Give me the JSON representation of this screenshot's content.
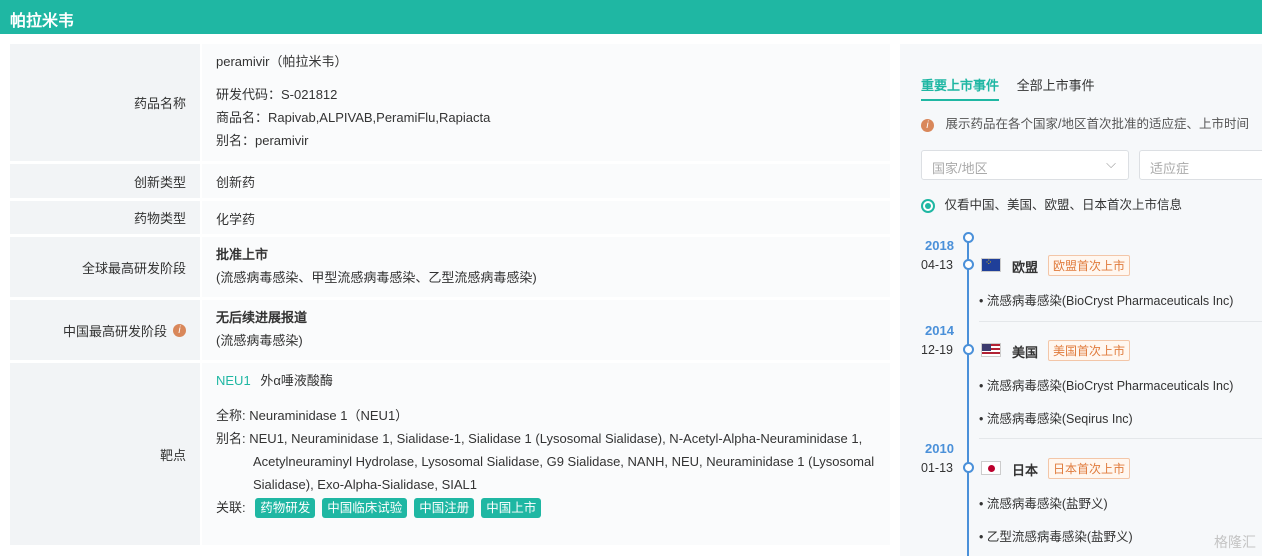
{
  "header": {
    "title": "帕拉米韦"
  },
  "drug": {
    "name_label": "药品名称",
    "name_main": "peramivir（帕拉米韦）",
    "code": "研发代码：S-021812",
    "trade": "商品名：Rapivab,ALPIVAB,PeramiFlu,Rapiacta",
    "alias": "别名：peramivir",
    "innov_label": "创新类型",
    "innov_value": "创新药",
    "type_label": "药物类型",
    "type_value": "化学药",
    "global_label": "全球最高研发阶段",
    "global_stage": "批准上市",
    "global_ind": "(流感病毒感染、甲型流感病毒感染、乙型流感病毒感染)",
    "china_label": "中国最高研发阶段",
    "china_stage": "无后续进展报道",
    "china_ind": "(流感病毒感染)",
    "target_label": "靶点",
    "target_link": "NEU1",
    "target_desc": "外α唾液酸酶",
    "target_full": "全称:  Neuraminidase 1（NEU1）",
    "target_alias_prefix": "别名:",
    "target_alias": "NEU1, Neuraminidase 1, Sialidase-1, Sialidase 1 (Lysosomal Sialidase), N-Acetyl-Alpha-Neuraminidase 1,",
    "target_alias2": "Acetylneuraminyl Hydrolase, Lysosomal Sialidase, G9 Sialidase, NANH, NEU, Neuraminidase 1 (Lysosomal",
    "target_alias3": "Sialidase), Exo-Alpha-Sialidase, SIAL1",
    "related_prefix": "关联:",
    "tags": [
      "药物研发",
      "中国临床试验",
      "中国注册",
      "中国上市"
    ]
  },
  "events": {
    "tabs": [
      "重要上市事件",
      "全部上市事件"
    ],
    "note": "展示药品在各个国家/地区首次批准的适应症、上市时间",
    "country_placeholder": "国家/地区",
    "indication_placeholder": "适应症",
    "radio_label": "仅看中国、美国、欧盟、日本首次上市信息",
    "items": [
      {
        "year": "2018",
        "date": "04-13",
        "country": "欧盟",
        "badge": "欧盟首次上市",
        "indications": [
          "• 流感病毒感染(BioCryst Pharmaceuticals Inc)"
        ]
      },
      {
        "year": "2014",
        "date": "12-19",
        "country": "美国",
        "badge": "美国首次上市",
        "indications": [
          "• 流感病毒感染(BioCryst Pharmaceuticals Inc)",
          "• 流感病毒感染(Seqirus Inc)"
        ]
      },
      {
        "year": "2010",
        "date": "01-13",
        "country": "日本",
        "badge": "日本首次上市",
        "indications": [
          "• 流感病毒感染(盐野义)",
          "• 乙型流感病毒感染(盐野义)"
        ]
      }
    ]
  },
  "watermark": "格隆汇",
  "colors": {
    "brand": "#1fb7a3",
    "timeline": "#4a90d9",
    "badge": "#e07b3c"
  }
}
